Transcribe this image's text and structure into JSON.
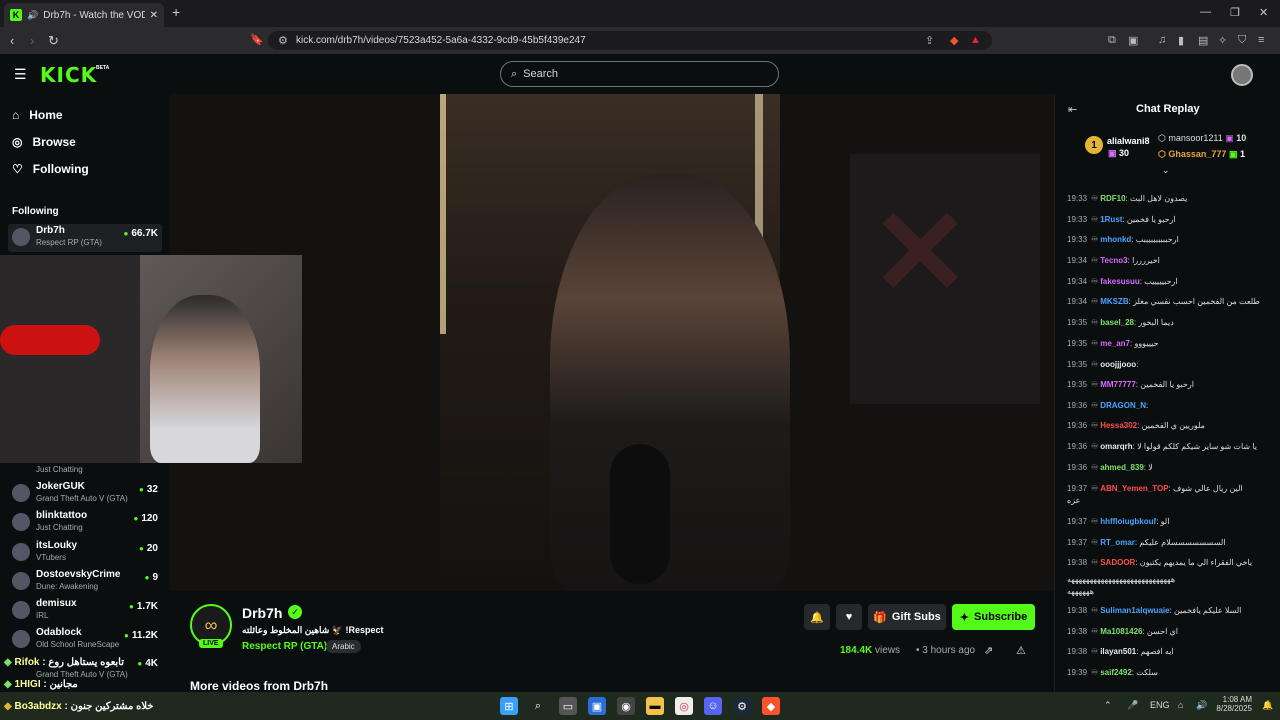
{
  "browser": {
    "tab_title": "Drb7h - Watch the VOD on K",
    "tab_favicon": "K",
    "url": "kick.com/drb7h/videos/7523a452-5a6a-4332-9cd9-45b5f439e247"
  },
  "header": {
    "logo": "KICK",
    "beta": "BETA",
    "search_placeholder": "Search"
  },
  "sidebar": {
    "nav": [
      {
        "label": "Home",
        "icon": "home-icon"
      },
      {
        "label": "Browse",
        "icon": "compass-icon"
      },
      {
        "label": "Following",
        "icon": "heart-icon"
      }
    ],
    "following_heading": "Following",
    "channels": [
      {
        "name": "Drb7h",
        "game": "Respect RP (GTA)",
        "viewers": "66.7K"
      },
      {
        "name": "",
        "game": "Just Chatting",
        "viewers": ""
      },
      {
        "name": "JokerGUK",
        "game": "Grand Theft Auto V (GTA)",
        "viewers": "32"
      },
      {
        "name": "blinktattoo",
        "game": "Just Chatting",
        "viewers": "120"
      },
      {
        "name": "itsLouky",
        "game": "VTubers",
        "viewers": "20"
      },
      {
        "name": "DostoevskyCrime",
        "game": "Dune: Awakening",
        "viewers": "9"
      },
      {
        "name": "demisux",
        "game": "IRL",
        "viewers": "1.7K"
      },
      {
        "name": "Odablock",
        "game": "Old School RuneScape",
        "viewers": "11.2K"
      },
      {
        "name": "",
        "game": "Grand Theft Auto V (GTA)",
        "viewers": "4K"
      }
    ]
  },
  "stream": {
    "channel": "Drb7h",
    "live_badge": "LIVE",
    "title": "شاهين المخلوط وعائلته 🦅 !Respect",
    "category": "Respect RP (GTA)",
    "language": "Arabic",
    "views_count": "184.4K",
    "views_label": "views",
    "ago": "3 hours ago",
    "gift_label": "Gift Subs",
    "subscribe_label": "Subscribe",
    "more_videos": "More videos from Drb7h"
  },
  "chat": {
    "title": "Chat Replay",
    "gifters": [
      {
        "rank": "1",
        "name": "alialwani8",
        "count": "30"
      },
      {
        "name": "mansoor1211",
        "count": "10"
      },
      {
        "name": "Ghassan_777",
        "count": "1"
      }
    ],
    "messages": [
      {
        "time": "19:33",
        "user": "RDF10",
        "color": "#7ee06b",
        "text": "يصدون لاهل البث"
      },
      {
        "time": "19:33",
        "user": "1Rust",
        "color": "#4aa3ff",
        "text": "ارحبو يا فخمين"
      },
      {
        "time": "19:33",
        "user": "mhonkd",
        "color": "#4aa3ff",
        "text": "ارحببببببببببب"
      },
      {
        "time": "19:34",
        "user": "Tecno3",
        "color": "#d36bff",
        "text": "اخيررررا"
      },
      {
        "time": "19:34",
        "user": "fakesusuu",
        "color": "#d36bff",
        "text": "ارحبيييييب"
      },
      {
        "time": "19:34",
        "user": "MKSZB",
        "color": "#4aa3ff",
        "text": "طلعت من الفخمين احسب نفسي مغلز"
      },
      {
        "time": "19:35",
        "user": "basel_28",
        "color": "#7ee06b",
        "text": "ديما البخور"
      },
      {
        "time": "19:35",
        "user": "me_an7",
        "color": "#d36bff",
        "text": "حيييووو"
      },
      {
        "time": "19:35",
        "user": "ooojjjooo",
        "color": "#e8e8e8",
        "text": ""
      },
      {
        "time": "19:35",
        "user": "MM77777",
        "color": "#d36bff",
        "text": "ارحبو يا الفخمين"
      },
      {
        "time": "19:36",
        "user": "DRAGON_N",
        "color": "#4aa3ff",
        "text": ""
      },
      {
        "time": "19:36",
        "user": "Hessa302",
        "color": "#ff4d4d",
        "text": "ملوريين ي الفخمين"
      },
      {
        "time": "19:36",
        "user": "omarqrh",
        "color": "#e8e8e8",
        "text": "يا شات شو ساير شيكم كلكم قولوا لا"
      },
      {
        "time": "19:36",
        "user": "ahmed_839",
        "color": "#7ee06b",
        "text": "لا"
      },
      {
        "time": "19:37",
        "user": "ABN_Yemen_TOP",
        "color": "#ff4d4d",
        "text": "الين ريال عالي شوف"
      },
      {
        "time": "",
        "user": "",
        "color": "#ddd",
        "text": "عزه"
      },
      {
        "time": "19:37",
        "user": "hhffloiugbkouf",
        "color": "#4aa3ff",
        "text": "الو"
      },
      {
        "time": "19:37",
        "user": "RT_omar",
        "color": "#4aa3ff",
        "text": "السسسسسسسلام عليكم"
      },
      {
        "time": "19:38",
        "user": "SADOOR",
        "color": "#ff4d4d",
        "text": "ياخي الفقراء الي ما يمديهم يكتبون"
      },
      {
        "time": "",
        "user": "",
        "color": "#ddd",
        "text": "ههههههههههههههههههههههههههههه"
      },
      {
        "time": "",
        "user": "",
        "color": "#ddd",
        "text": "ههههههه"
      },
      {
        "time": "19:38",
        "user": "Suliman1alqwuaie",
        "color": "#4aa3ff",
        "text": "السلا عليكم يافخمين"
      },
      {
        "time": "19:38",
        "user": "Ma1081426",
        "color": "#7ee06b",
        "text": "اي احسن"
      },
      {
        "time": "19:38",
        "user": "ilayan501",
        "color": "#e8e8e8",
        "text": "ايه افصهم"
      },
      {
        "time": "19:39",
        "user": "saif2492",
        "color": "#7ee06b",
        "text": "سلكت"
      }
    ]
  },
  "overlay_chat": [
    {
      "user": "Rifok",
      "text": "تابعوه يستاهل روع"
    },
    {
      "user": "1HIGI",
      "text": "مجانين"
    },
    {
      "user": "Bo3abdzx",
      "text": "خلاه مشتركين جنون"
    }
  ],
  "taskbar": {
    "lang": "ENG",
    "time": "1:08 AM",
    "date": "8/28/2025"
  },
  "colors": {
    "accent": "#53fc18"
  }
}
